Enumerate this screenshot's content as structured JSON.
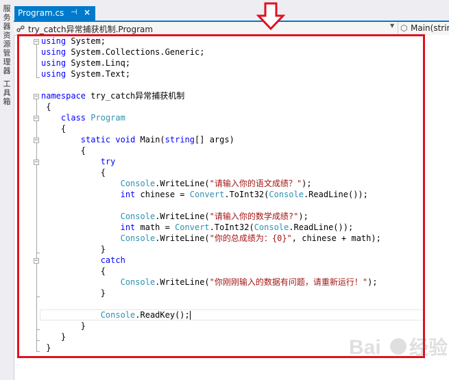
{
  "sidebar": {
    "items": [
      {
        "label": "服务器资源管理器"
      },
      {
        "label": "工具箱"
      }
    ]
  },
  "tab": {
    "label": "Program.cs",
    "pin": "⊣",
    "close": "×"
  },
  "navbar": {
    "left": "try_catch异常捕获机制.Program",
    "right": "Main(strin"
  },
  "code": {
    "l1": {
      "a": "using",
      "b": " System;"
    },
    "l2": {
      "a": "using",
      "b": " System.Collections.Generic;"
    },
    "l3": {
      "a": "using",
      "b": " System.Linq;"
    },
    "l4": {
      "a": "using",
      "b": " System.Text;"
    },
    "l5": {
      "a": "namespace",
      "b": " try_catch异常捕获机制"
    },
    "l6": {
      "a": " {"
    },
    "l7": {
      "a": "    ",
      "b": "class",
      "c": " ",
      "d": "Program"
    },
    "l8": {
      "a": "    {"
    },
    "l9": {
      "a": "        ",
      "b": "static",
      "c": " ",
      "d": "void",
      "e": " Main(",
      "f": "string",
      "g": "[] args)"
    },
    "l10": {
      "a": "        {"
    },
    "l11": {
      "a": "            ",
      "b": "try"
    },
    "l12": {
      "a": "            {"
    },
    "l13": {
      "a": "                ",
      "b": "Console",
      "c": ".WriteLine(",
      "d": "\"请输入你的语文成绩？\"",
      "e": ");"
    },
    "l14": {
      "a": "                ",
      "b": "int",
      "c": " chinese = ",
      "d": "Convert",
      "e": ".ToInt32(",
      "f": "Console",
      "g": ".ReadLine());"
    },
    "l15": {
      "a": "                ",
      "b": "Console",
      "c": ".WriteLine(",
      "d": "\"请输入你的数学成绩?\"",
      "e": ");"
    },
    "l16": {
      "a": "                ",
      "b": "int",
      "c": " math = ",
      "d": "Convert",
      "e": ".ToInt32(",
      "f": "Console",
      "g": ".ReadLine());"
    },
    "l17": {
      "a": "                ",
      "b": "Console",
      "c": ".WriteLine(",
      "d": "\"你的总成绩为：{0}\"",
      "e": ", chinese + math);"
    },
    "l18": {
      "a": "            }"
    },
    "l19": {
      "a": "            ",
      "b": "catch"
    },
    "l20": {
      "a": "            {"
    },
    "l21": {
      "a": "                ",
      "b": "Console",
      "c": ".WriteLine(",
      "d": "\"你刚刚输入的数据有问题，请重新运行！\"",
      "e": ");"
    },
    "l22": {
      "a": "            }"
    },
    "l23": {
      "a": "            ",
      "b": "Console",
      "c": ".ReadKey();"
    },
    "l24": {
      "a": "        }"
    },
    "l25": {
      "a": "    }"
    },
    "l26": {
      "a": " }"
    }
  },
  "colors": {
    "accent": "#007acc",
    "keyword": "#0000ff",
    "type": "#2b91af",
    "string": "#a31515",
    "annotation": "#e01020"
  },
  "icons": {
    "tab_pin": "pin-icon",
    "tab_close": "close-icon",
    "nav_class": "class-icon",
    "nav_method": "method-icon",
    "annotation_arrow": "down-arrow-icon"
  }
}
